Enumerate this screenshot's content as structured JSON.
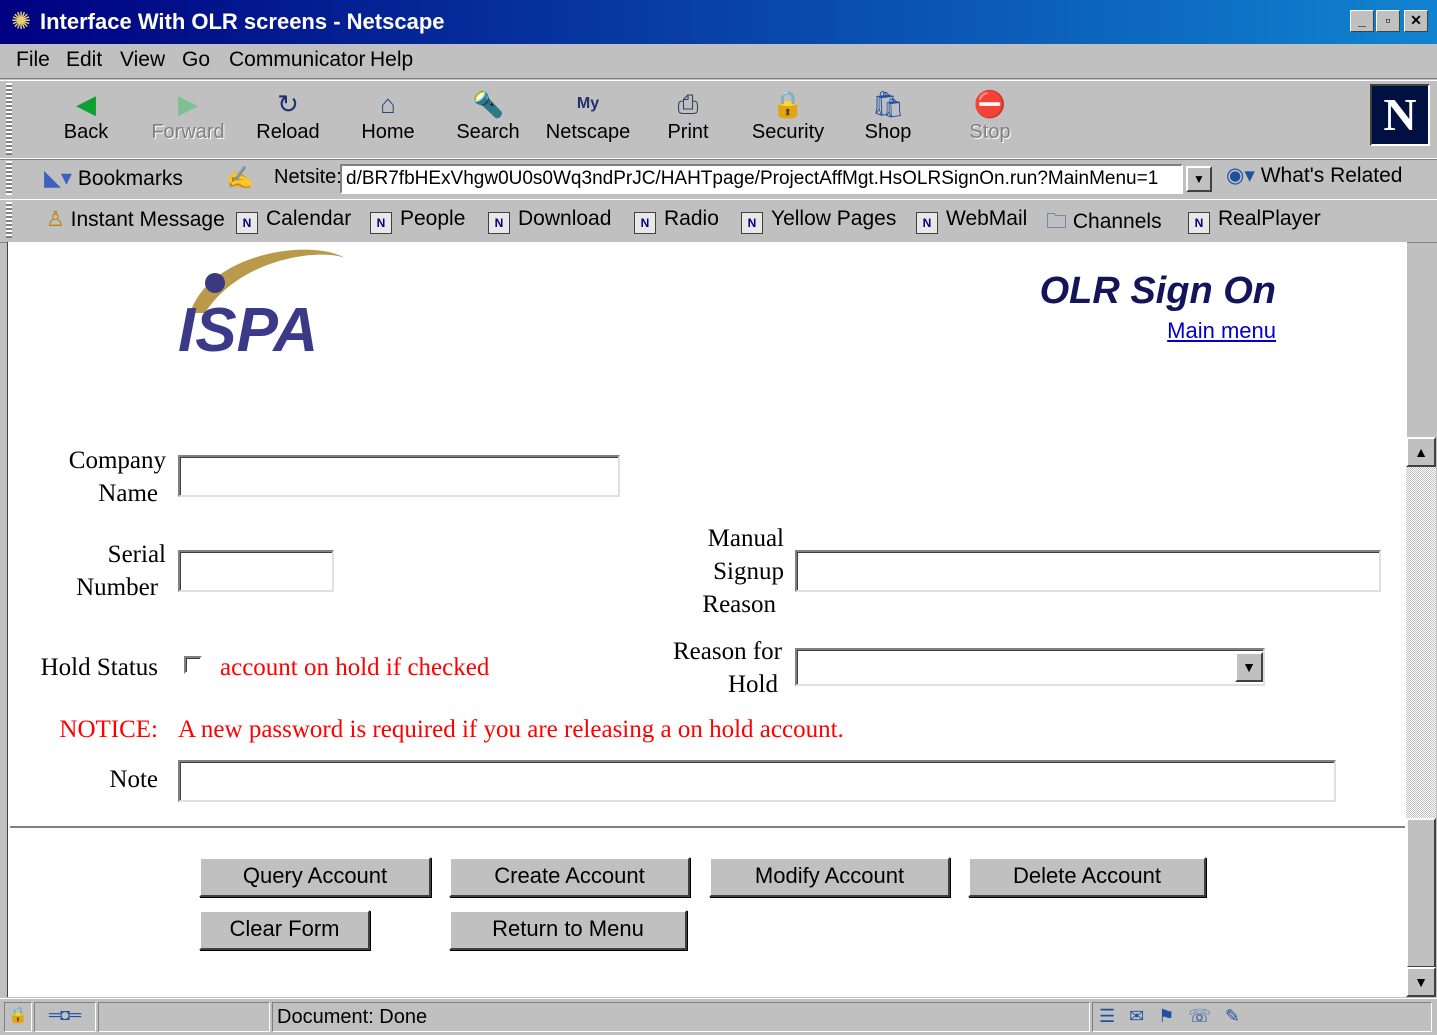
{
  "window": {
    "title": "Interface With OLR screens - Netscape",
    "app_icon": "netscape-window-icon"
  },
  "menubar": [
    "File",
    "Edit",
    "View",
    "Go",
    "Communicator",
    "Help"
  ],
  "nav_toolbar": {
    "back": "Back",
    "forward": "Forward",
    "reload": "Reload",
    "home": "Home",
    "search": "Search",
    "netscape": "Netscape",
    "print": "Print",
    "security": "Security",
    "shop": "Shop",
    "stop": "Stop"
  },
  "location_bar": {
    "bookmarks": "Bookmarks",
    "netsite_label": "Netsite:",
    "url": "d/BR7fbHExVhgw0U0s0Wq3ndPrJC/HAHTpage/ProjectAffMgt.HsOLRSignOn.run?MainMenu=1",
    "whats_related": "What's Related"
  },
  "personal_toolbar": [
    "Instant Message",
    "Calendar",
    "People",
    "Download",
    "Radio",
    "Yellow Pages",
    "WebMail",
    "Channels",
    "RealPlayer"
  ],
  "page": {
    "logo_text": "ISPA",
    "title": "OLR Sign On",
    "main_menu_link": "Main menu",
    "form": {
      "company_name_label1": "Company",
      "company_name_label2": "Name",
      "company_name_value": "",
      "serial_label1": "Serial",
      "serial_label2": "Number",
      "serial_value": "",
      "manual_label1": "Manual",
      "manual_label2": "Signup",
      "manual_label3": "Reason",
      "manual_value": "",
      "hold_status_label": "Hold Status",
      "hold_checkbox_text": "account on hold if checked",
      "hold_checked": false,
      "reason_hold_label1": "Reason for",
      "reason_hold_label2": "Hold",
      "reason_hold_selected": "",
      "notice_label": "NOTICE:",
      "notice_text": "A new password is required if you are releasing a on hold account.",
      "note_label": "Note",
      "note_value": ""
    },
    "buttons": {
      "query": "Query Account",
      "create": "Create Account",
      "modify": "Modify Account",
      "delete": "Delete Account",
      "clear": "Clear Form",
      "return": "Return to Menu"
    }
  },
  "status_bar": {
    "text": "Document: Done"
  },
  "colors": {
    "title_bar": "#000080",
    "notice_red": "#ff0000",
    "page_title": "#14145a",
    "link": "#0000cc"
  }
}
